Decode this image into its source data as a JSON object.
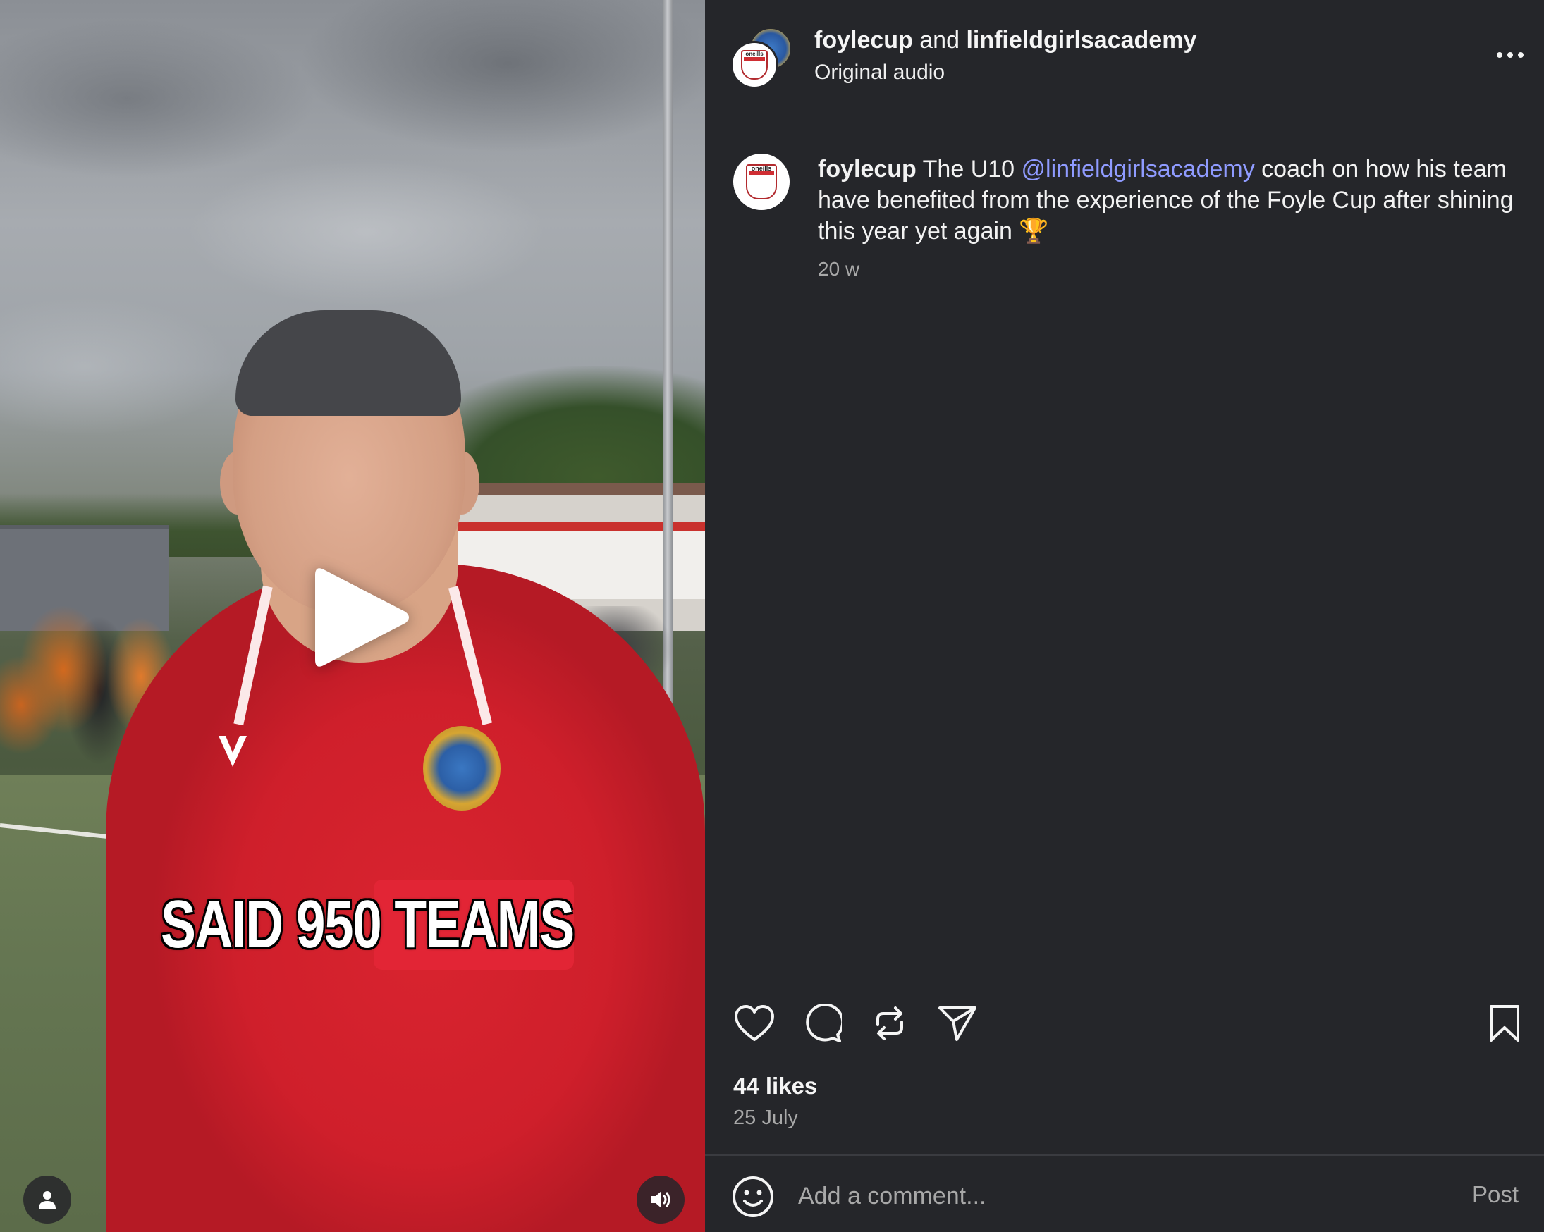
{
  "video": {
    "caption_overlay": "SAID 950 TEAMS",
    "play_icon": "play-icon",
    "user_tag_icon": "person-icon",
    "sound_icon": "speaker-icon"
  },
  "header": {
    "author_1": "foylecup",
    "joiner": "and",
    "author_2": "linfieldgirlsacademy",
    "audio": "Original audio",
    "more_icon": "more-icon"
  },
  "post": {
    "username": "foylecup",
    "text_before": "The U10",
    "mention": "@linfieldgirlsacademy",
    "text_after": "coach on how his team have benefited from the experience of the Foyle Cup after shining this year yet again",
    "emoji": "🏆",
    "time": "20 w"
  },
  "avatar_logo_text": "oneills",
  "stats": {
    "likes": "44 likes",
    "date": "25 July"
  },
  "comment": {
    "placeholder": "Add a comment...",
    "post_label": "Post"
  },
  "colors": {
    "background": "#25262a",
    "mention": "#8f9bff",
    "muted": "#a8a8a8"
  }
}
